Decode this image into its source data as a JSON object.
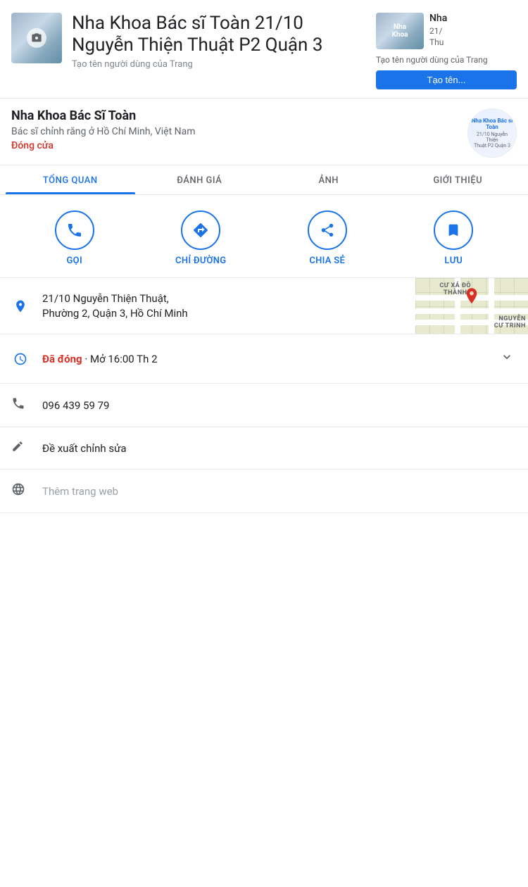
{
  "page": {
    "title": "Nha Khoa Bác sĩ Toàn 21/10 Nguyễn Thiện Thuật P2 Quận 3",
    "create_username_label": "Tạo tên người dùng của Trang",
    "business_name": "Nha Khoa Bác Sĩ Toàn",
    "business_category": "Bác sĩ chỉnh răng ở Hồ Chí Minh, Việt Nam",
    "business_status": "Đóng cửa",
    "right_card_title": "Nha",
    "right_card_sub": "21/",
    "right_card_sub2": "Thu",
    "right_card_btn_label": "Tạo tên...",
    "logo_line1": "Nha Khoa Bác sĩ Toàn",
    "logo_line2": "21/10 Nguyễn Thiện",
    "logo_line3": "Thuật P2 Quận 3"
  },
  "tabs": [
    {
      "id": "tong-quan",
      "label": "TỔNG QUAN",
      "active": true
    },
    {
      "id": "danh-gia",
      "label": "ĐÁNH GIÁ",
      "active": false
    },
    {
      "id": "anh",
      "label": "ẢNH",
      "active": false
    },
    {
      "id": "gioi-thieu",
      "label": "GIỚI THIỆU",
      "active": false
    }
  ],
  "actions": [
    {
      "id": "goi",
      "label": "GỌI",
      "icon": "📞"
    },
    {
      "id": "chi-duong",
      "label": "CHỈ ĐƯỜNG",
      "icon": "◈"
    },
    {
      "id": "chia-se",
      "label": "CHIA SẺ",
      "icon": "⟨"
    },
    {
      "id": "luu",
      "label": "LƯU",
      "icon": "🔖"
    }
  ],
  "address": {
    "line1": "21/10 Nguyễn Thiện Thuật,",
    "line2": "Phường 2, Quận 3, Hồ Chí Minh"
  },
  "map": {
    "label_top": "CƯ XÁ ĐÔ\nTHÀNH",
    "label_bottom": "NGUYỄN\nCƯ TRINH"
  },
  "hours": {
    "status_closed": "Đã đóng",
    "status_open_info": " · Mở 16:00 Th 2"
  },
  "phone": {
    "number": "096 439 59 79"
  },
  "edit": {
    "label": "Đề xuất chỉnh sửa"
  },
  "web": {
    "label": "Thêm trang web"
  }
}
